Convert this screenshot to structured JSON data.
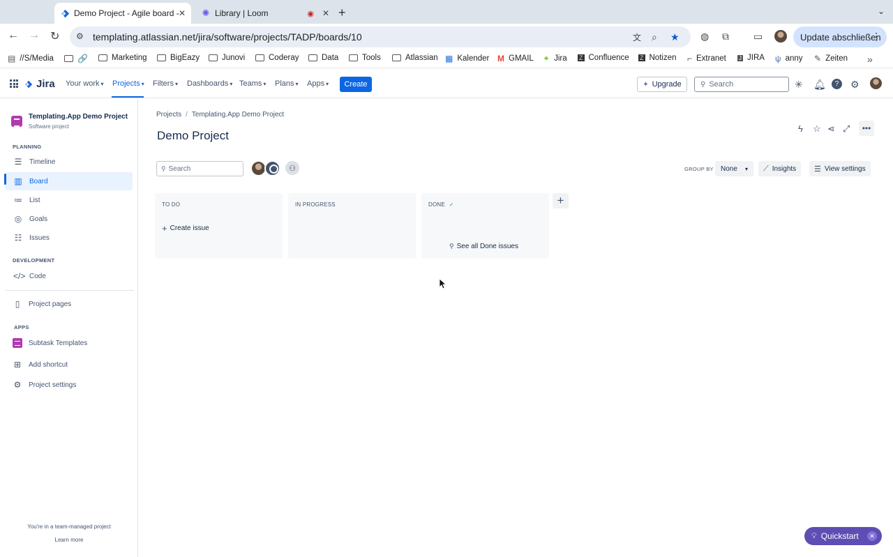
{
  "browser": {
    "tabs": [
      {
        "title": "Demo Project - Agile board -",
        "active": true
      },
      {
        "title": "Library | Loom",
        "active": false
      }
    ],
    "url": "templating.atlassian.net/jira/software/projects/TADP/boards/10",
    "update_label": "Update abschließen",
    "bookmarks": [
      "//S/Media",
      "Marketing",
      "BigEazy",
      "Junovi",
      "Coderay",
      "Data",
      "Tools",
      "Atlassian",
      "Kalender",
      "GMAIL",
      "Jira",
      "Confluence",
      "Notizen",
      "Extranet",
      "JIRA",
      "anny",
      "Zeiten"
    ]
  },
  "topnav": {
    "logo": "Jira",
    "items": [
      "Your work",
      "Projects",
      "Filters",
      "Dashboards",
      "Teams",
      "Plans",
      "Apps"
    ],
    "create_label": "Create",
    "upgrade_label": "Upgrade",
    "search_placeholder": "Search",
    "accent": "#0c66e4"
  },
  "sidebar": {
    "project_name": "Templating.App Demo Project",
    "project_type": "Software project",
    "planning_heading": "PLANNING",
    "planning_items": [
      "Timeline",
      "Board",
      "List",
      "Goals",
      "Issues"
    ],
    "development_heading": "DEVELOPMENT",
    "development_items": [
      "Code"
    ],
    "project_pages": "Project pages",
    "apps_heading": "APPS",
    "apps_items": [
      "Subtask Templates"
    ],
    "add_shortcut": "Add shortcut",
    "project_settings": "Project settings",
    "team_note": "You're in a team-managed project",
    "learn_more": "Learn more"
  },
  "main": {
    "breadcrumbs": [
      "Projects",
      "Templating.App Demo Project"
    ],
    "title": "Demo Project",
    "search_placeholder": "Search",
    "group_by_label": "GROUP BY",
    "group_by_value": "None",
    "insights_label": "Insights",
    "view_settings_label": "View settings",
    "columns": [
      {
        "title": "TO DO",
        "action": "Create issue"
      },
      {
        "title": "IN PROGRESS"
      },
      {
        "title": "DONE",
        "action": "See all Done issues"
      }
    ]
  },
  "quickstart_label": "Quickstart"
}
